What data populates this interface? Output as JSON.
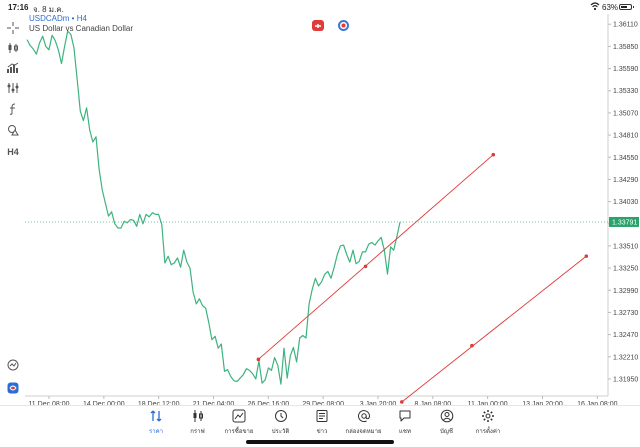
{
  "status_bar": {
    "time": "17:16",
    "date": "จ. 8 ม.ค.",
    "battery_percent": "63%",
    "battery_level": 0.63
  },
  "chart_header": {
    "symbol": "USDCADm",
    "timeframe_suffix": " • H4",
    "description": "US Dollar vs Canadian Dollar"
  },
  "left_toolbar": [
    {
      "name": "crosshair-icon"
    },
    {
      "name": "candlestick-icon"
    },
    {
      "name": "indicators-icon"
    },
    {
      "name": "objects-icon"
    },
    {
      "name": "function-icon"
    },
    {
      "name": "shapes-icon"
    },
    {
      "name": "timeframe",
      "label": "H4"
    },
    {
      "name": "zoom-icon"
    },
    {
      "name": "app-icon"
    }
  ],
  "colors": {
    "price_line": "#3db37e",
    "trend_line": "#e03a3a",
    "current_price_label_bg": "#2aa36a",
    "current_price_line": "#3db37e",
    "accent_blue": "#2a6dd4"
  },
  "chart_data": {
    "type": "line",
    "title": "",
    "xlabel": "",
    "ylabel": "",
    "x_tick_labels": [
      "11 Dec 08:00",
      "14 Dec 00:00",
      "18 Dec 12:00",
      "21 Dec 04:00",
      "26 Dec 16:00",
      "29 Dec 08:00",
      "3 Jan 20:00",
      "8 Jan 08:00",
      "11 Jan 00:00",
      "13 Jan 20:00",
      "16 Jan 08:00"
    ],
    "y_tick_labels": [
      "1.36110",
      "1.35850",
      "1.35590",
      "1.35330",
      "1.35070",
      "1.34810",
      "1.34550",
      "1.34290",
      "1.34030",
      "1.33770",
      "1.33510",
      "1.33250",
      "1.32990",
      "1.32730",
      "1.32470",
      "1.32210",
      "1.31950"
    ],
    "ylim": [
      1.3175,
      1.3623
    ],
    "current_price": "1.33791",
    "series": [
      {
        "values": [
          1.3593,
          1.3586,
          1.3582,
          1.3576,
          1.3589,
          1.3597,
          1.3585,
          1.3581,
          1.3598,
          1.3592,
          1.3581,
          1.3565,
          1.3585,
          1.3603,
          1.3599,
          1.3583,
          1.3546,
          1.3509,
          1.3498,
          1.3513,
          1.3487,
          1.3473,
          1.3479,
          1.3441,
          1.3417,
          1.3401,
          1.3386,
          1.3391,
          1.3377,
          1.3372,
          1.3372,
          1.338,
          1.3378,
          1.3382,
          1.3381,
          1.3374,
          1.3388,
          1.3377,
          1.3388,
          1.3385,
          1.339,
          1.3388,
          1.3388,
          1.3376,
          1.3331,
          1.3339,
          1.3329,
          1.3331,
          1.3337,
          1.3326,
          1.3346,
          1.3332,
          1.3325,
          1.3297,
          1.3283,
          1.3289,
          1.3281,
          1.3278,
          1.3261,
          1.3241,
          1.3245,
          1.3231,
          1.3236,
          1.3204,
          1.3206,
          1.3198,
          1.3193,
          1.3192,
          1.3196,
          1.32,
          1.3207,
          1.3205,
          1.3201,
          1.3195,
          1.3216,
          1.319,
          1.3194,
          1.3208,
          1.3205,
          1.322,
          1.3211,
          1.3189,
          1.3231,
          1.3196,
          1.3222,
          1.3232,
          1.3215,
          1.3243,
          1.3246,
          1.3243,
          1.3283,
          1.33,
          1.3313,
          1.3304,
          1.3309,
          1.3318,
          1.3321,
          1.3313,
          1.3326,
          1.3341,
          1.3351,
          1.3352,
          1.3341,
          1.3332,
          1.3346,
          1.333,
          1.3333,
          1.3344,
          1.3344,
          1.3353,
          1.3355,
          1.3352,
          1.3357,
          1.3361,
          1.3346,
          1.3318,
          1.335,
          1.3346,
          1.3362,
          1.3379
        ]
      }
    ],
    "trend_lines": [
      {
        "points": [
          [
            0.3795,
            1.3218
          ],
          [
            0.5537,
            1.3327
          ],
          [
            0.7614,
            1.3458
          ]
        ]
      },
      {
        "points": [
          [
            0.6127,
            1.3168
          ],
          [
            0.7267,
            1.3234
          ],
          [
            0.9127,
            1.3339
          ]
        ]
      }
    ]
  },
  "bottom_tabs": [
    {
      "name": "tab-quotes",
      "label": "ราคา",
      "icon": "quotes-icon",
      "active": true
    },
    {
      "name": "tab-chart",
      "label": "กราฟ",
      "icon": "chart-icon",
      "active": false
    },
    {
      "name": "tab-trade",
      "label": "การซื้อขาย",
      "icon": "trade-icon",
      "active": false
    },
    {
      "name": "tab-history",
      "label": "ประวัติ",
      "icon": "history-icon",
      "active": false
    },
    {
      "name": "tab-news",
      "label": "ข่าว",
      "icon": "news-icon",
      "active": false
    },
    {
      "name": "tab-mailbox",
      "label": "กล่องจดหมาย",
      "icon": "mail-icon",
      "active": false
    },
    {
      "name": "tab-chat",
      "label": "แชท",
      "icon": "chat-icon",
      "active": false
    },
    {
      "name": "tab-accounts",
      "label": "บัญชี",
      "icon": "account-icon",
      "active": false
    },
    {
      "name": "tab-settings",
      "label": "การตั้งค่า",
      "icon": "gear-icon",
      "active": false
    }
  ]
}
